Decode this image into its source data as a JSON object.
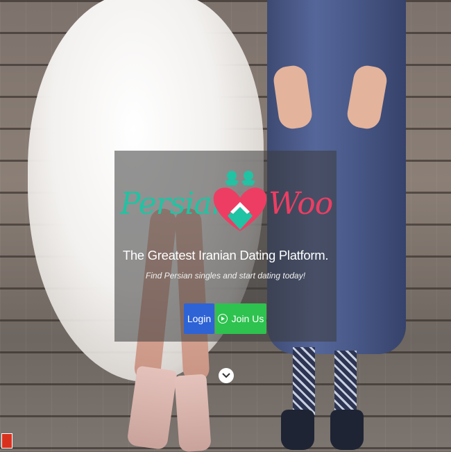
{
  "hero": {
    "logo": {
      "left_word": "Persian",
      "right_word": "Woo"
    },
    "tagline": "The Greatest Iranian Dating Platform.",
    "subtagline": "Find Persian singles and start dating today!",
    "buttons": {
      "login_label": "Login",
      "join_label": "Join Us"
    }
  },
  "icons": {
    "join": "play-circle-icon",
    "scroll": "chevron-down-icon",
    "corner": "badge-icon"
  },
  "colors": {
    "logo_teal": "#20c3a3",
    "logo_pink": "#ee3d63",
    "login_button": "#2e63d6",
    "join_button": "#2ec24f"
  }
}
